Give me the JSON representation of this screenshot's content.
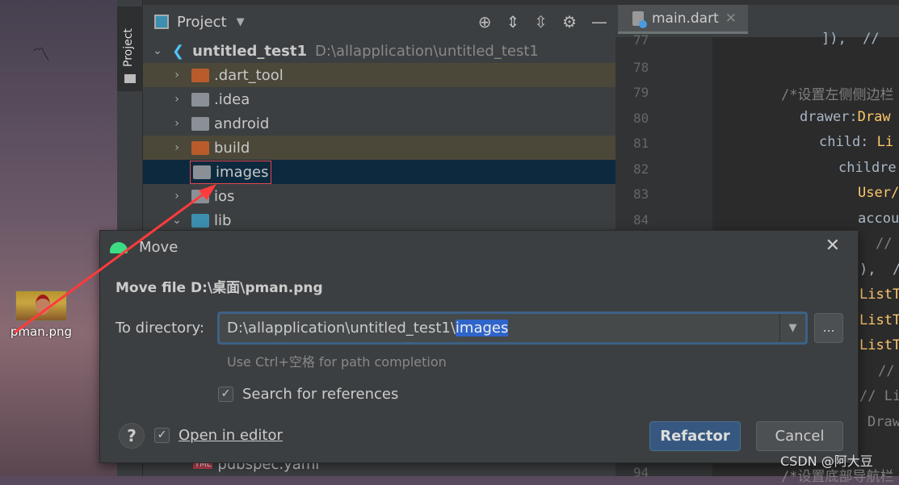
{
  "desktop": {
    "file_label": "pman.png"
  },
  "sidebar": {
    "tab_label": "Project"
  },
  "project": {
    "title": "Project",
    "root": {
      "name": "untitled_test1",
      "path": "D:\\allapplication\\untitled_test1"
    },
    "items": [
      {
        "name": ".dart_tool",
        "color": "#b85c2c",
        "excluded": true
      },
      {
        "name": ".idea",
        "color": "#8a9096"
      },
      {
        "name": "android",
        "color": "#8a9096"
      },
      {
        "name": "build",
        "color": "#b85c2c",
        "excluded": true
      },
      {
        "name": "images",
        "color": "#8a9096",
        "selected": true
      },
      {
        "name": "ios",
        "color": "#8a9096"
      },
      {
        "name": "lib",
        "color": "#3d8fb0"
      }
    ],
    "bottom_item": "pubspec.yaml"
  },
  "editor": {
    "tab": "main.dart",
    "line_numbers": [
      "77",
      "78",
      "79",
      "80",
      "81",
      "82",
      "83",
      "84",
      "94"
    ],
    "code": {
      "l77": "]),  // ",
      "l79": "/*设置左侧侧边栏",
      "l80a": "drawer:",
      "l80b": "Draw",
      "l81a": "child: ",
      "l81b": "Li",
      "l82": "childre",
      "l83": "User/",
      "l84": "accou",
      "r1": "//",
      "r2": "),  /",
      "r3": "ListT",
      "r4": "ListT",
      "r5": "ListT",
      "r6": "//",
      "r7": "// Li",
      "r8": "Draw",
      "l94": "/*设置底部导航栏"
    }
  },
  "dialog": {
    "title": "Move",
    "heading": "Move file D:\\桌面\\pman.png",
    "to_directory_label": "To directory:",
    "directory_value": "D:\\allapplication\\untitled_test1\\",
    "directory_selected": "images",
    "browse": "...",
    "hint": "Use Ctrl+空格 for path completion",
    "search_refs": {
      "label": "Search for references",
      "checked": true
    },
    "open_in_editor": {
      "label": "Open in editor",
      "checked": true
    },
    "help": "?",
    "refactor": "Refactor",
    "cancel": "Cancel"
  },
  "watermark": "CSDN @阿大豆",
  "colors": {
    "annotation": "#ff3b3b",
    "accent": "#365880"
  }
}
